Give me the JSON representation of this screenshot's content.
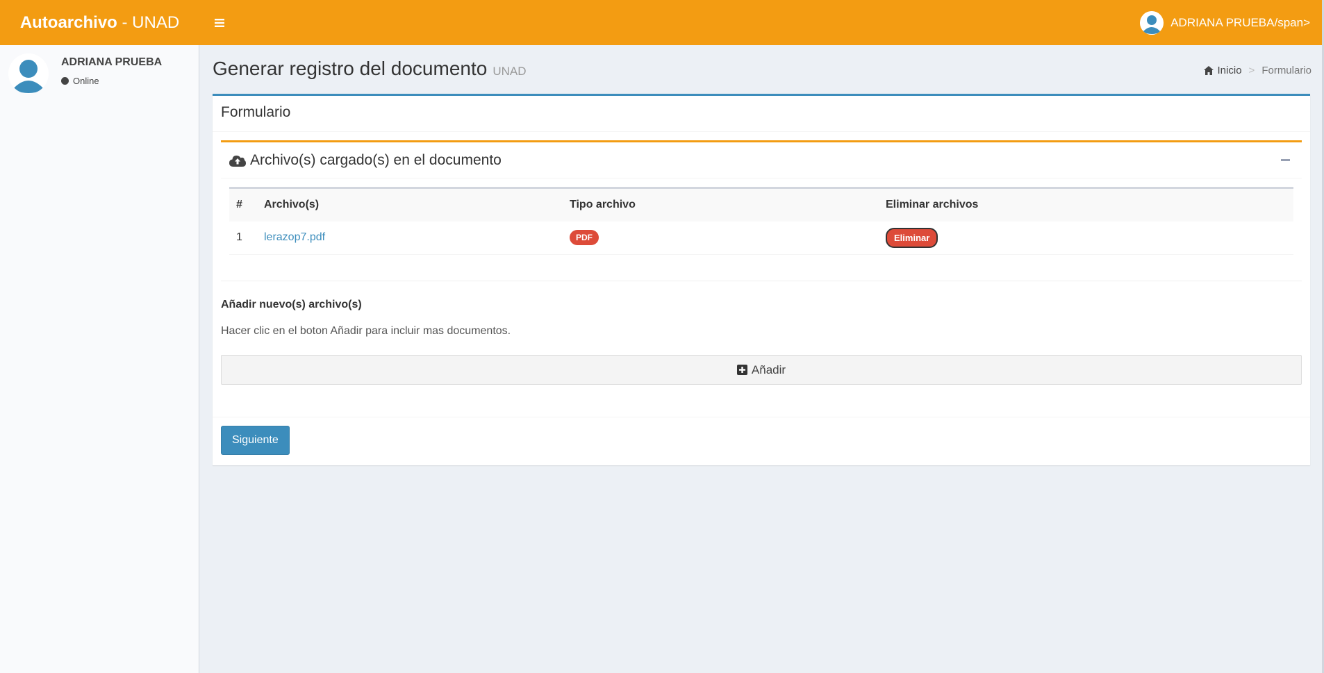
{
  "header": {
    "brand_bold": "Autoarchivo",
    "brand_rest": " - UNAD",
    "user_label": "ADRIANA PRUEBA/span>"
  },
  "sidebar": {
    "user_name": "ADRIANA PRUEBA",
    "status": "Online"
  },
  "page": {
    "title": "Generar registro del documento",
    "subtitle": "UNAD",
    "breadcrumb": [
      "Inicio",
      "Formulario"
    ]
  },
  "form": {
    "title": "Formulario",
    "files_box_title": "Archivo(s) cargado(s) en el documento",
    "table": {
      "headers": [
        "#",
        "Archivo(s)",
        "Tipo archivo",
        "Eliminar archivos"
      ],
      "rows": [
        {
          "num": "1",
          "file": "lerazop7.pdf",
          "type": "PDF",
          "action": "Eliminar"
        }
      ]
    },
    "add_title": "Añadir nuevo(s) archivo(s)",
    "add_help": "Hacer clic en el boton Añadir para incluir mas documentos.",
    "add_button": "Añadir",
    "next_button": "Siguiente"
  },
  "colors": {
    "topbar": "#f39c12",
    "primary": "#3c8dbc",
    "danger": "#dd4b39"
  }
}
